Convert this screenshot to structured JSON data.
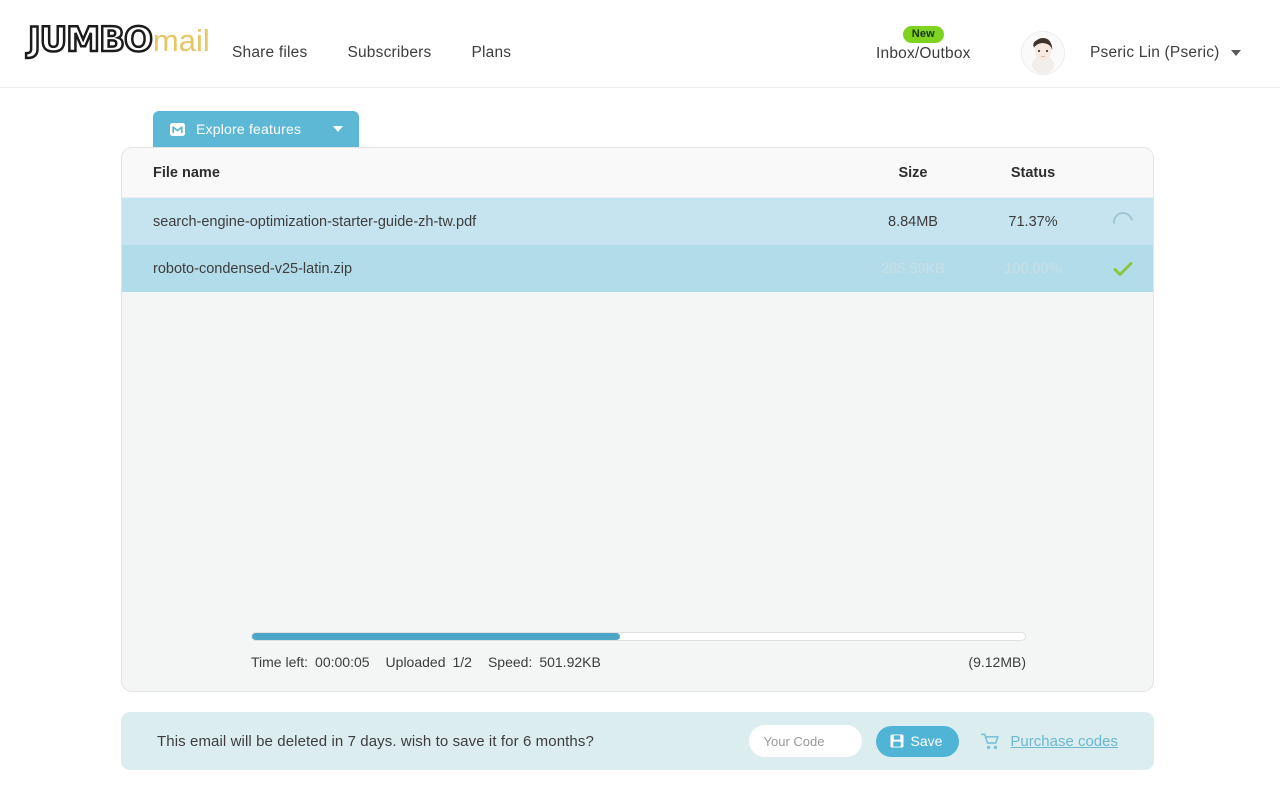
{
  "brand": {
    "logo_primary": "JUMBO",
    "logo_secondary": "mail",
    "accent_blue": "#5cb8d4",
    "accent_gold": "#e7c765",
    "badge_green": "#7ed321"
  },
  "nav": {
    "links": [
      {
        "label": "Share files",
        "icon": "none"
      },
      {
        "label": "Subscribers",
        "icon": "none"
      },
      {
        "label": "Plans",
        "icon": "none"
      }
    ],
    "inbox": {
      "label": "Inbox/Outbox",
      "badge": "New"
    },
    "avatar_icon": "user-avatar-photo",
    "user": {
      "name": "Pseric Lin (Pseric)",
      "caret_icon": "caret-down-icon"
    }
  },
  "explore": {
    "label": "Explore features",
    "icon": "mail-box-icon",
    "caret_icon": "chevron-down-icon"
  },
  "table": {
    "headers": {
      "name": "File name",
      "size": "Size",
      "status": "Status"
    },
    "rows": [
      {
        "name": "search-engine-optimization-starter-guide-zh-tw.pdf",
        "size": "8.84MB",
        "status": "71.37%",
        "state_icon": "spinner-icon"
      },
      {
        "name": "roboto-condensed-v25-latin.zip",
        "size": "285.59KB",
        "status": "100.00%",
        "state_icon": "check-icon"
      }
    ]
  },
  "progress": {
    "percent": 47.6,
    "time_left_label": "Time left:",
    "time_left_value": "00:00:05",
    "uploaded_label": "Uploaded",
    "uploaded_value": "1/2",
    "speed_label": "Speed:",
    "speed_value": "501.92KB",
    "total": "(9.12MB)"
  },
  "banner": {
    "message": "This email will be deleted in 7 days. wish to save it for 6 months?",
    "code_placeholder": "Your Code",
    "code_value": "",
    "save_label": "Save",
    "save_icon": "save-disk-icon",
    "cart_icon": "shopping-cart-icon",
    "purchase_label": "Purchase codes"
  }
}
